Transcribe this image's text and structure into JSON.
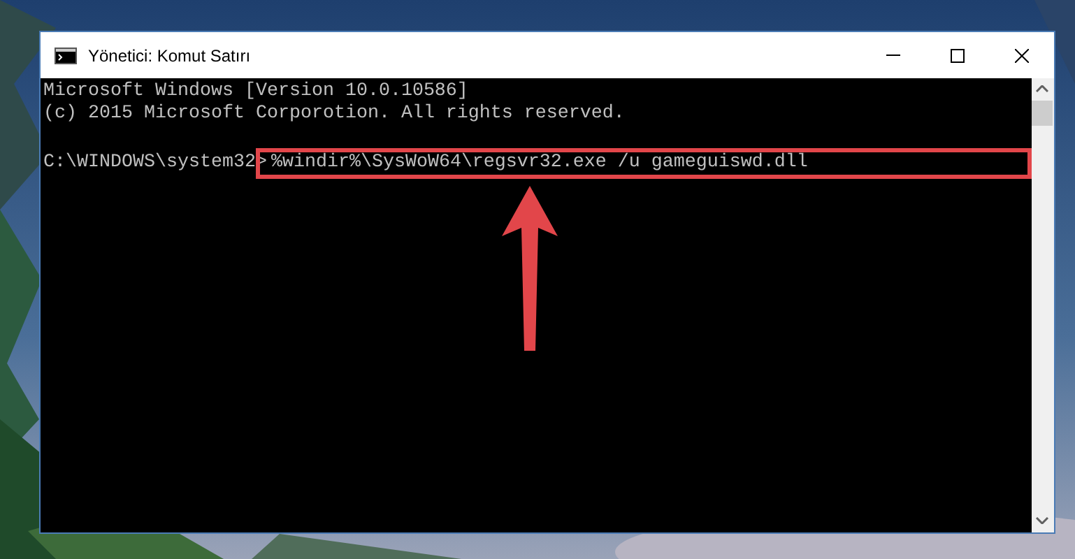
{
  "window": {
    "title": "Yönetici: Komut Satırı"
  },
  "console": {
    "lines": [
      "Microsoft Windows [Version 10.0.10586]",
      "(c) 2015 Microsoft Corporotion. All rights reserved."
    ],
    "prompt": "C:\\WINDOWS\\system32>",
    "command": "%windir%\\SysWoW64\\regsvr32.exe /u gameguiswd.dll"
  }
}
